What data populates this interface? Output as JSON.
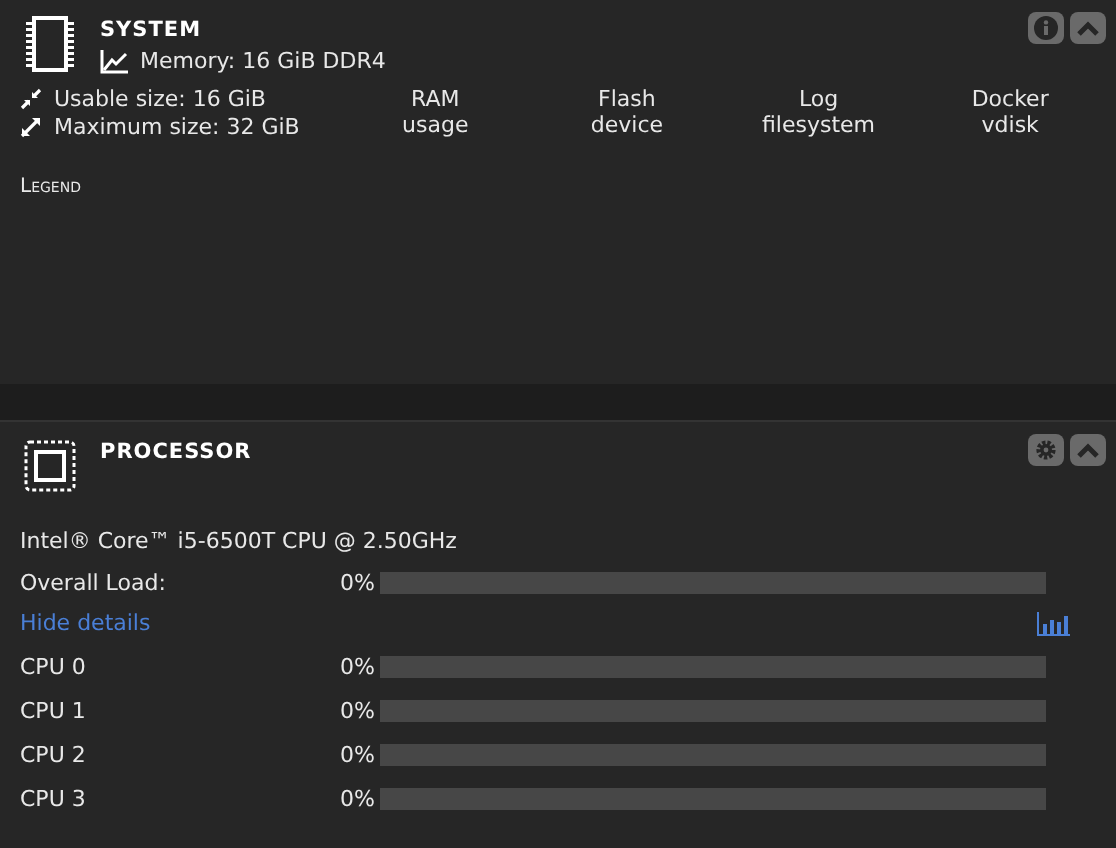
{
  "system": {
    "title": "SYSTEM",
    "memory": "Memory: 16 GiB DDR4",
    "usable": "Usable size: 16 GiB",
    "maximum": "Maximum size: 32 GiB",
    "columns": [
      {
        "line1": "RAM",
        "line2": "usage"
      },
      {
        "line1": "Flash",
        "line2": "device"
      },
      {
        "line1": "Log",
        "line2": "filesystem"
      },
      {
        "line1": "Docker",
        "line2": "vdisk"
      }
    ],
    "legend": "Legend"
  },
  "processor": {
    "title": "PROCESSOR",
    "model": "Intel® Core™ i5-6500T CPU @ 2.50GHz",
    "overall": {
      "label": "Overall Load:",
      "reading": "0%",
      "level": 0
    },
    "toggle": "Hide details",
    "cpus": [
      {
        "label": "CPU 0",
        "reading": "0%",
        "level": 0
      },
      {
        "label": "CPU 1",
        "reading": "0%",
        "level": 0
      },
      {
        "label": "CPU 2",
        "reading": "0%",
        "level": 0
      },
      {
        "label": "CPU 3",
        "reading": "0%",
        "level": 0
      }
    ]
  }
}
